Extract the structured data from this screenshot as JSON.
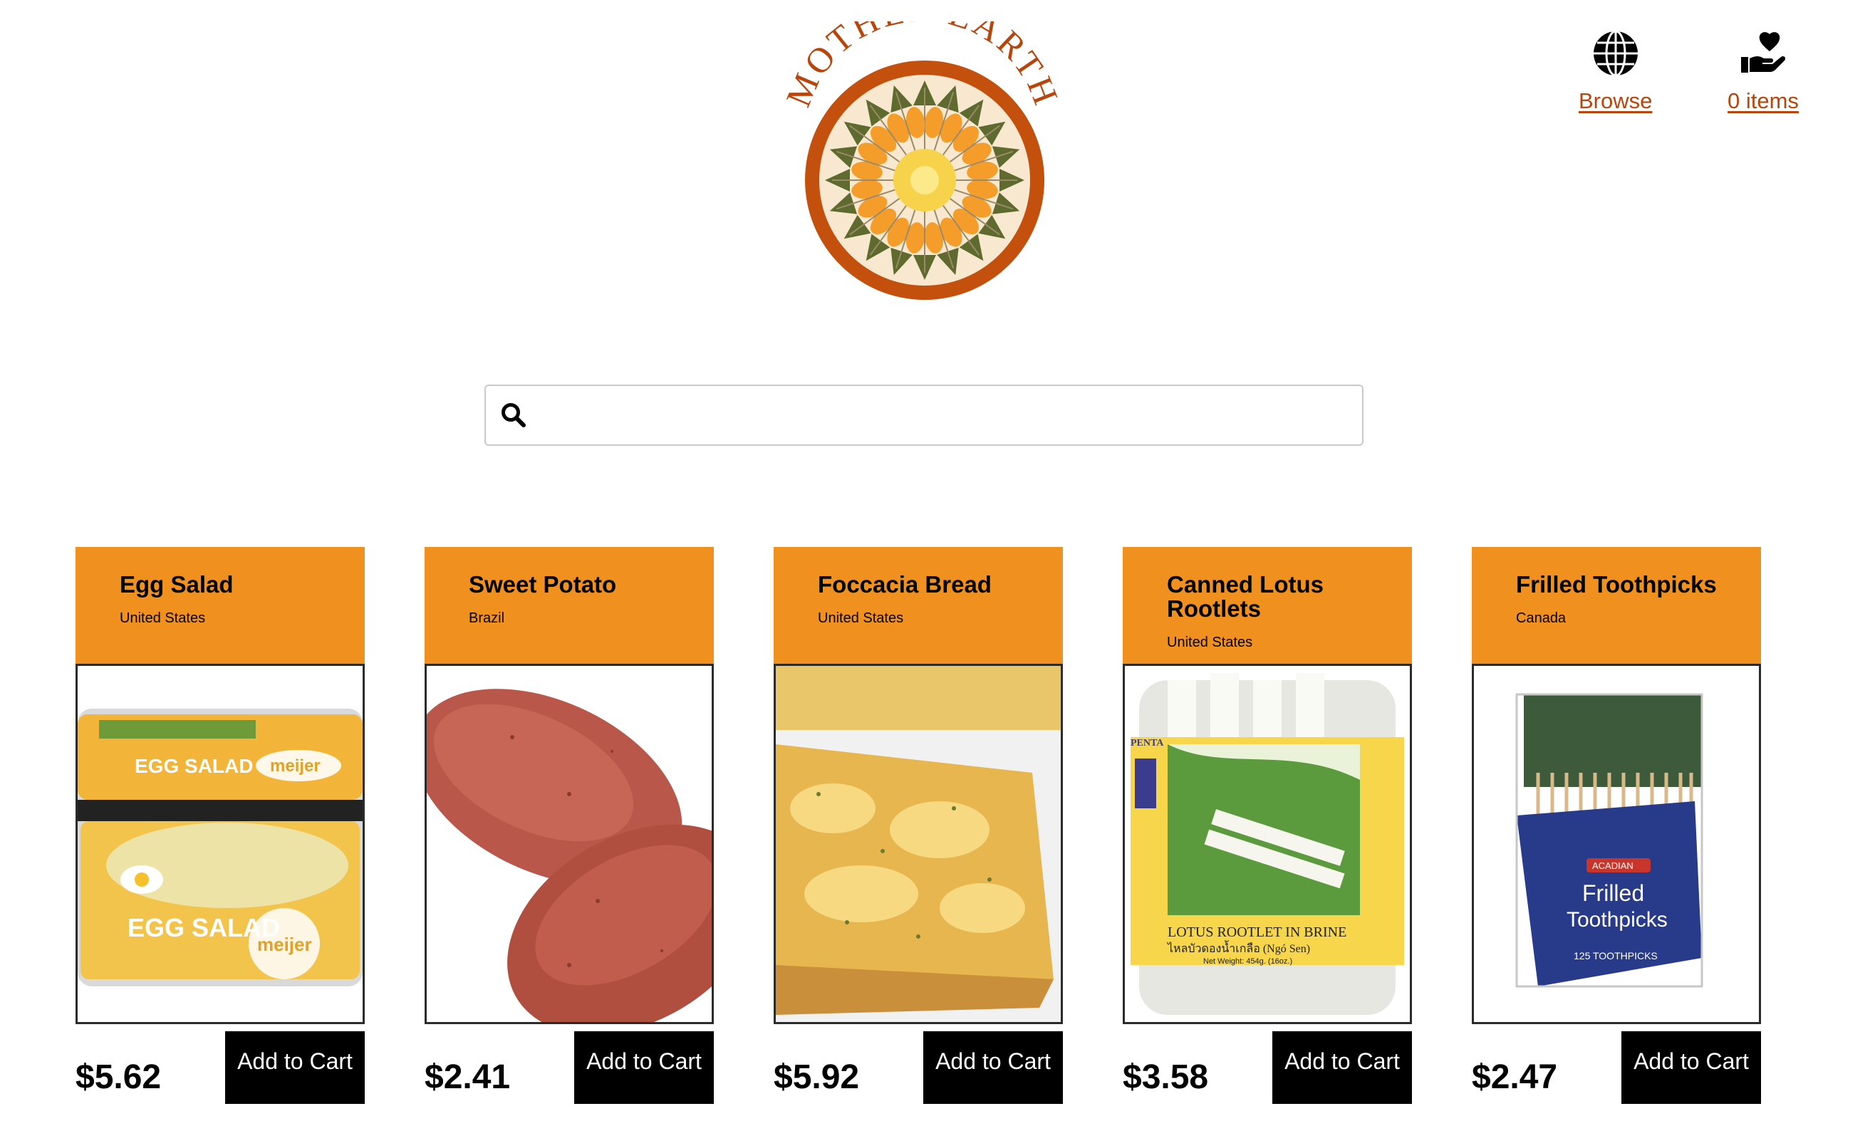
{
  "header": {
    "logo_text": "MOTHER EARTH",
    "nav": {
      "browse_label": "Browse",
      "cart_label": "0 items"
    }
  },
  "search": {
    "value": "",
    "placeholder": ""
  },
  "colors": {
    "brand_orange": "#f0901e",
    "link_rust": "#b8450b",
    "logo_ring": "#c4500e",
    "button_black": "#000000"
  },
  "products": [
    {
      "name": "Egg Salad",
      "origin": "United States",
      "price": "$5.62",
      "button_label": "Add to Cart"
    },
    {
      "name": "Sweet Potato",
      "origin": "Brazil",
      "price": "$2.41",
      "button_label": "Add to Cart"
    },
    {
      "name": "Foccacia Bread",
      "origin": "United States",
      "price": "$5.92",
      "button_label": "Add to Cart"
    },
    {
      "name": "Canned Lotus Rootlets",
      "origin": "United States",
      "price": "$3.58",
      "button_label": "Add to Cart"
    },
    {
      "name": "Frilled Toothpicks",
      "origin": "Canada",
      "price": "$2.47",
      "button_label": "Add to Cart"
    }
  ],
  "product_image_text": {
    "egg_salad_pack": "EGG SALAD",
    "egg_salad_brand": "meijer",
    "lotus_brand": "PENTA",
    "lotus_label": "LOTUS ROOTLET IN BRINE",
    "lotus_label_native": "ไหลบัวดองน้ำเกลือ (Ngó Sen)",
    "lotus_weight": "Net Weight: 454g. (16oz.)",
    "toothpick_brand": "ACADIAN",
    "toothpick_line1": "Frilled",
    "toothpick_line2": "Toothpicks",
    "toothpick_count": "125 TOOTHPICKS"
  }
}
